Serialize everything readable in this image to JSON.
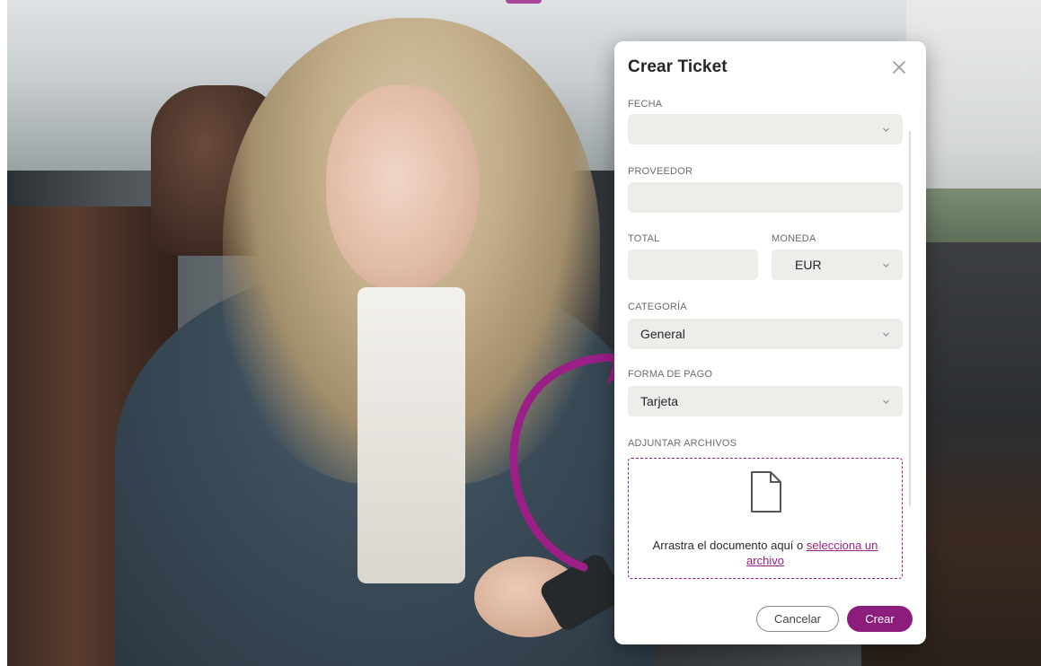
{
  "modal": {
    "title": "Crear Ticket",
    "close_icon": "close-icon"
  },
  "fields": {
    "fecha": {
      "label": "FECHA",
      "value": ""
    },
    "proveedor": {
      "label": "PROVEEDOR",
      "value": ""
    },
    "total": {
      "label": "TOTAL",
      "value": ""
    },
    "moneda": {
      "label": "MONEDA",
      "value": "EUR"
    },
    "categoria": {
      "label": "CATEGORÍA",
      "value": "General"
    },
    "forma_pago": {
      "label": "FORMA DE PAGO",
      "value": "Tarjeta"
    }
  },
  "attachments": {
    "label": "ADJUNTAR ARCHIVOS",
    "icon": "file-icon",
    "text": "Arrastra el documento aquí o",
    "link": "selecciona un archivo"
  },
  "buttons": {
    "cancel": "Cancelar",
    "create": "Crear"
  },
  "colors": {
    "accent": "#8c1d7d",
    "field_bg": "#ededea",
    "text": "#262626",
    "label": "#6b6b6b"
  }
}
